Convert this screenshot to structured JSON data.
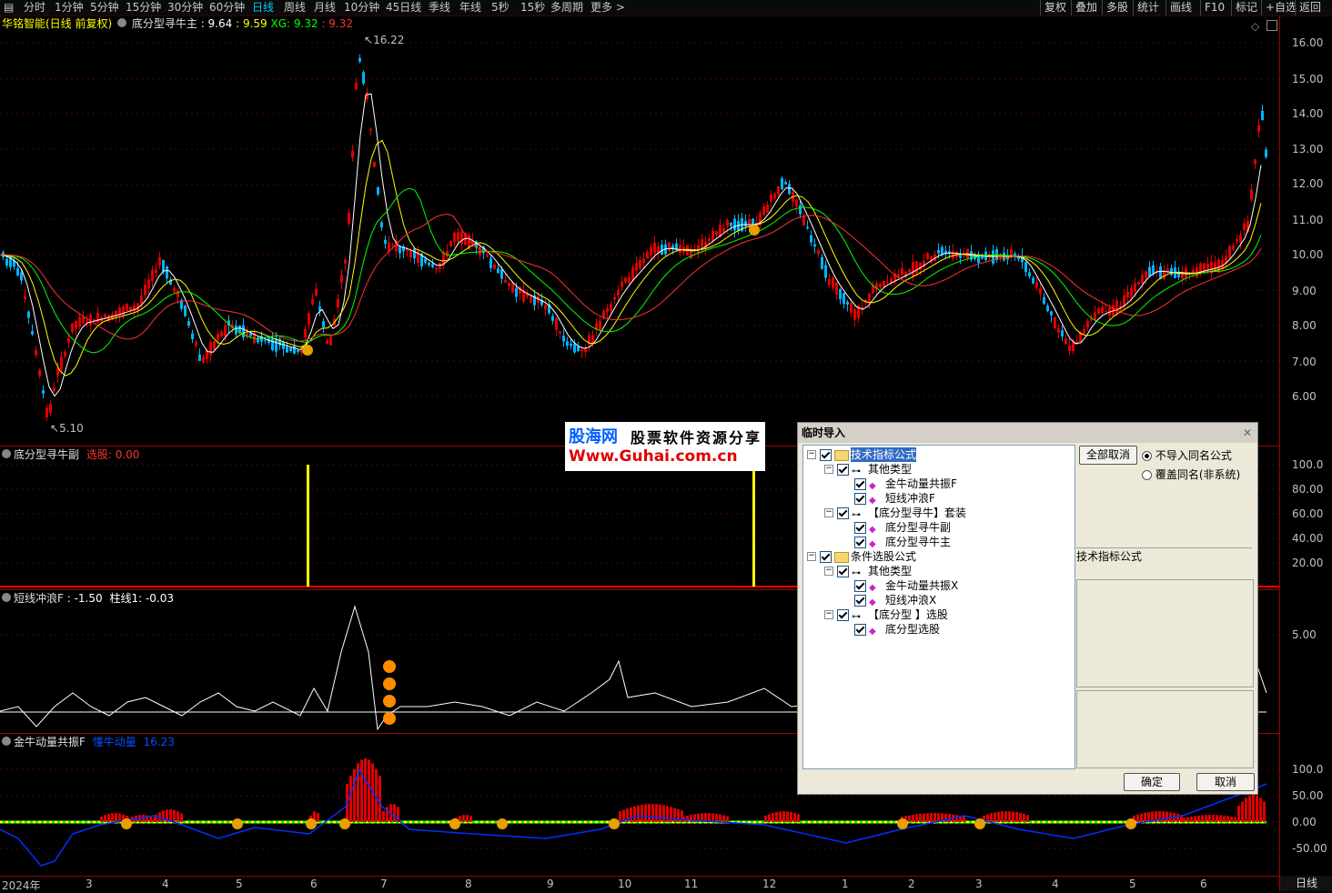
{
  "toolbar": {
    "periods": [
      "分时",
      "1分钟",
      "5分钟",
      "15分钟",
      "30分钟",
      "60分钟",
      "日线",
      "周线",
      "月线",
      "10分钟",
      "45日线",
      "季线",
      "年线",
      "5秒",
      "15秒",
      "多周期",
      "更多 >"
    ],
    "active_period": "日线",
    "right_buttons": [
      "复权",
      "叠加",
      "多股",
      "统计",
      "画线",
      "F10",
      "标记",
      "+自选",
      "返回"
    ]
  },
  "main_panel": {
    "title": "华铭智能(日线 前复权)",
    "indicator": "底分型寻牛主",
    "v1": ": 9.64",
    "v2": ": 9.59",
    "xg_label": "XG: 9.32",
    "v3": ": 9.32",
    "high_label": "16.22",
    "low_label": "5.10",
    "y_ticks": [
      "16.00",
      "15.00",
      "14.00",
      "13.00",
      "12.00",
      "11.00",
      "10.00",
      "9.00",
      "8.00",
      "7.00",
      "6.00"
    ]
  },
  "panel2": {
    "title": "底分型寻牛副",
    "label": "选股: 0.00",
    "y_ticks": [
      "100.0",
      "80.00",
      "60.00",
      "40.00",
      "20.00"
    ]
  },
  "panel3": {
    "title": "短线冲浪F",
    "label": ": -1.50",
    "label2": "柱线1: -0.03",
    "y_ticks": [
      "5.00"
    ]
  },
  "panel4": {
    "title": "金牛动量共振F",
    "label": "懂牛动量",
    "value": "16.23",
    "y_ticks": [
      "100.0",
      "50.00",
      "0.00",
      "-50.00"
    ]
  },
  "x_axis": {
    "labels": [
      "2024年",
      "3",
      "4",
      "5",
      "6",
      "7",
      "8",
      "9",
      "10",
      "11",
      "12",
      "1",
      "2",
      "3",
      "4",
      "5",
      "6"
    ],
    "period_tag": "日线"
  },
  "watermark": {
    "line1": "股海网",
    "line1b": "股票软件资源分享",
    "line2": "Www.Guhai.com.cn"
  },
  "dialog": {
    "title": "临时导入",
    "tree": [
      {
        "label": "技术指标公式",
        "level": 0,
        "folder": true,
        "selected": true
      },
      {
        "label": "其他类型",
        "level": 1
      },
      {
        "label": "金牛动量共振F",
        "level": 2
      },
      {
        "label": "短线冲浪F",
        "level": 2
      },
      {
        "label": "【底分型寻牛】套装",
        "level": 1
      },
      {
        "label": "底分型寻牛副",
        "level": 2
      },
      {
        "label": "底分型寻牛主",
        "level": 2
      },
      {
        "label": "条件选股公式",
        "level": 0,
        "folder": true
      },
      {
        "label": "其他类型",
        "level": 1
      },
      {
        "label": "金牛动量共振X",
        "level": 2
      },
      {
        "label": "短线冲浪X",
        "level": 2
      },
      {
        "label": "【底分型 】选股",
        "level": 1
      },
      {
        "label": "底分型选股",
        "level": 2
      }
    ],
    "cancel_all": "全部取消",
    "radio1": "不导入同名公式",
    "radio2": "覆盖同名(非系统)",
    "info_label": "技术指标公式",
    "ok": "确定",
    "cancel": "取消"
  },
  "colors": {
    "up": "#e00000",
    "down": "#00b4ff",
    "ma5": "#ffffff",
    "ma10": "#ffff00",
    "ma20": "#00ff00",
    "ma60": "#ff3030",
    "border": "#a00000"
  }
}
